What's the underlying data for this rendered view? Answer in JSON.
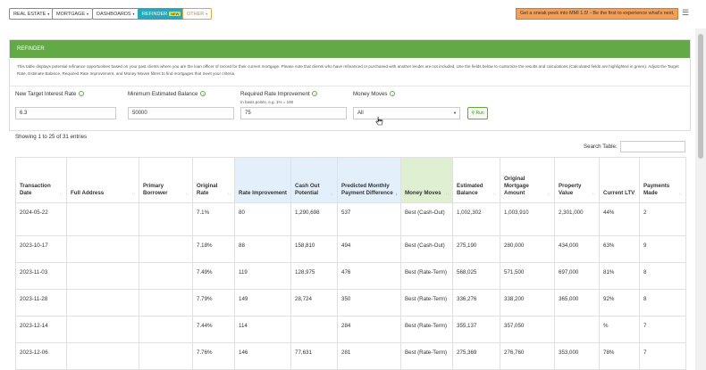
{
  "nav": {
    "items": [
      {
        "label": "REAL ESTATE",
        "caret": "▾"
      },
      {
        "label": "MORTGAGE",
        "caret": "▾"
      },
      {
        "label": "DASHBOARDS",
        "caret": "▾"
      },
      {
        "label": "REFINDER",
        "badge": "NEW"
      },
      {
        "label": "OTHER",
        "caret": "▾"
      }
    ],
    "promo": "Get a sneak peek into MMI 1.5! - Be the first to experience what's next.",
    "menu_icon": "☰"
  },
  "panel": {
    "title": "REFINDER",
    "description": "This table displays potential refinance opportunities based on your past clients where you are the loan officer of record for their current mortgage. Please note that clients who have refinanced or purchased with another lender are not included. Use the fields below to customize the results and calculations (Calculated fields are highlighted in green). Adjust the Target Rate, Estimate Balance, Required Rate Improvement, and Money Moves filters to find mortgages that meet your criteria."
  },
  "filters": {
    "target_rate_label": "New Target Interest Rate",
    "target_rate_value": "6.3",
    "min_balance_label": "Minimum Estimated Balance",
    "min_balance_value": "50000",
    "rate_improvement_label": "Required Rate Improvement",
    "rate_improvement_hint": "In basis points, e.g. 1% = 100",
    "rate_improvement_value": "75",
    "money_moves_label": "Money Moves",
    "money_moves_value": "All",
    "run_label": "Run",
    "info_icon": "i"
  },
  "table_info": {
    "showing": "Showing 1 to 25 of 31 entries",
    "search_label": "Search Table:"
  },
  "columns": [
    "Transaction Date",
    "Full Address",
    "Primary Borrower",
    "Original Rate",
    "Rate Improvement",
    "Cash Out Potential",
    "Predicted Monthly Payment Difference",
    "Money Moves",
    "Estimated Balance",
    "Original Mortgage Amount",
    "Property Value",
    "Current LTV",
    "Payments Made"
  ],
  "sort_glyph": "↑↓",
  "sort_active_glyph": "↓",
  "rows": [
    [
      "2024-05-22",
      "",
      "",
      "7.1%",
      "80",
      "1,290,698",
      "537",
      "Best (Cash-Out)",
      "1,002,302",
      "1,003,910",
      "2,301,000",
      "44%",
      "2"
    ],
    [
      "2023-10-17",
      "",
      "",
      "7.18%",
      "88",
      "158,810",
      "494",
      "Best (Cash-Out)",
      "275,190",
      "280,000",
      "434,000",
      "63%",
      "9"
    ],
    [
      "2023-11-03",
      "",
      "",
      "7.49%",
      "119",
      "128,975",
      "476",
      "Best (Rate-Term)",
      "568,025",
      "571,500",
      "697,000",
      "81%",
      "8"
    ],
    [
      "2023-11-28",
      "",
      "",
      "7.79%",
      "149",
      "28,724",
      "350",
      "Best (Rate-Term)",
      "336,276",
      "338,200",
      "365,000",
      "92%",
      "8"
    ],
    [
      "2023-12-14",
      "",
      "",
      "7.44%",
      "114",
      "",
      "284",
      "Best (Rate-Term)",
      "355,137",
      "357,050",
      "",
      "%",
      "7"
    ],
    [
      "2023-12-06",
      "",
      "",
      "7.76%",
      "146",
      "77,631",
      "281",
      "Best (Rate-Term)",
      "275,369",
      "276,760",
      "353,000",
      "78%",
      "7"
    ]
  ]
}
